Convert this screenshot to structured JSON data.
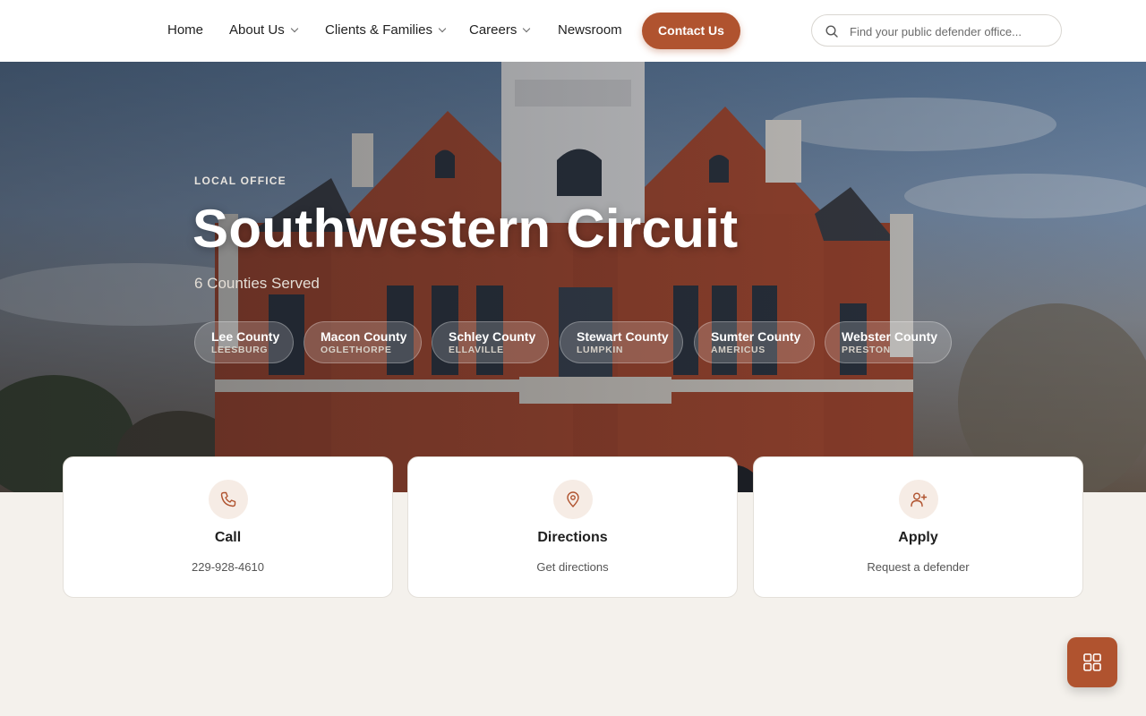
{
  "nav": {
    "items": [
      {
        "label": "Home",
        "dropdown": false
      },
      {
        "label": "About Us",
        "dropdown": true
      },
      {
        "label": "Clients & Families",
        "dropdown": true
      },
      {
        "label": "Careers",
        "dropdown": true
      },
      {
        "label": "Newsroom",
        "dropdown": false
      }
    ],
    "contact_label": "Contact Us",
    "search_placeholder": "Find your public defender office..."
  },
  "hero": {
    "eyebrow": "LOCAL OFFICE",
    "title": "Southwestern Circuit",
    "subtitle": "6 Counties Served",
    "counties": [
      {
        "name": "Lee County",
        "city": "LEESBURG"
      },
      {
        "name": "Macon County",
        "city": "OGLETHORPE"
      },
      {
        "name": "Schley County",
        "city": "ELLAVILLE"
      },
      {
        "name": "Stewart County",
        "city": "LUMPKIN"
      },
      {
        "name": "Sumter County",
        "city": "AMERICUS"
      },
      {
        "name": "Webster County",
        "city": "PRESTON"
      }
    ]
  },
  "cards": [
    {
      "title": "Call",
      "desc": "229-928-4610",
      "icon": "phone-icon"
    },
    {
      "title": "Directions",
      "desc": "Get directions",
      "icon": "map-pin-icon"
    },
    {
      "title": "Apply",
      "desc": "Request a defender",
      "icon": "user-plus-icon"
    }
  ],
  "fab": {
    "icon": "grid-icon"
  },
  "colors": {
    "accent": "#b0532f",
    "accent_soft": "#f6ece5",
    "page_bg": "#f4f1ec"
  }
}
